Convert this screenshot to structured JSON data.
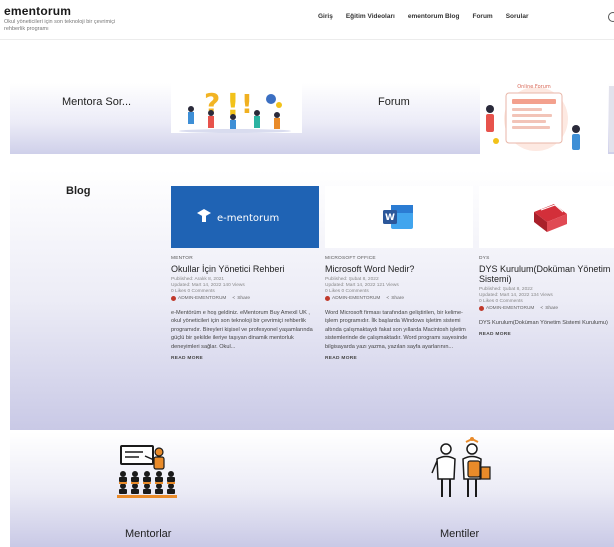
{
  "header": {
    "brand_title": "ementorum",
    "brand_subtitle": "Okul yöneticileri için son teknoloji bir çevrimiçi rehberlik programı",
    "nav": [
      "Giriş",
      "Eğitim Videoları",
      "ementorum Blog",
      "Forum",
      "Sorular"
    ]
  },
  "features": {
    "sor_label": "Mentora Sor...",
    "forum_label": "Forum",
    "forum_image_text": "Online Forum",
    "mentorlar_label": "Mentorlar",
    "mentiler_label": "Mentiler"
  },
  "blog": {
    "heading": "Blog",
    "cards": [
      {
        "image_text": "e-mentorum",
        "category": "MENTOR",
        "title": "Okullar İçin Yönetici Rehberi",
        "published": "Published: Aralık 8, 2021",
        "updated": "Updated: Mart 14, 2022   140 Views",
        "likes": "0 Likes   0 Comments",
        "author": "ADMIN-EMENTORUM",
        "share": "Share",
        "excerpt": "e-Mentörüm e hoş geldiniz. eMentorum Buy Amexil UK , okul yöneticileri için son teknoloji bir çevrimiçi rehberlik programıdır. Bireyleri kişisel ve profesyonel yaşamlarında güçlü bir şekilde ileriye taşıyan dinamik mentorluk deneyimleri sağlar. Okul...",
        "read_more": "READ MORE"
      },
      {
        "image_text": "W",
        "category": "MICROSOFT OFFICE",
        "title": "Microsoft Word Nedir?",
        "published": "Published: Şubat 8, 2022",
        "updated": "Updated: Mart 14, 2022   121 Views",
        "likes": "0 Likes   0 Comments",
        "author": "ADMIN-EMENTORUM",
        "share": "Share",
        "excerpt": "Word Microsoft firması tarafından geliştirilen, bir kelime-işlem programıdır. İlk başlarda Windows işletim sistemi altında çalışmaktaydı fakat son yıllarda Macintosh işletim sistemlerinde de çalışmaktadır. Word programı sayesinde bilgisayarda yazı yazma, yazılan sayfa ayarlarının...",
        "read_more": "READ MORE"
      },
      {
        "image_text": "",
        "category": "DYS",
        "title": "DYS Kurulum(Doküman Yönetim Sistemi)",
        "published": "Published: Şubat 8, 2022",
        "updated": "Updated: Mart 14, 2022   134 Views",
        "likes": "0 Likes   0 Comments",
        "author": "ADMIN-EMENTORUM",
        "share": "Share",
        "excerpt": "DYS Kurulum(Doküman Yönetim Sistemi Kurulumu)",
        "read_more": "READ MORE"
      }
    ]
  },
  "colors": {
    "band_bottom": "#c9c9e6",
    "ementorum_blue": "#1f63b4",
    "word_blue": "#2b579a",
    "dys_red": "#d32f3a"
  }
}
